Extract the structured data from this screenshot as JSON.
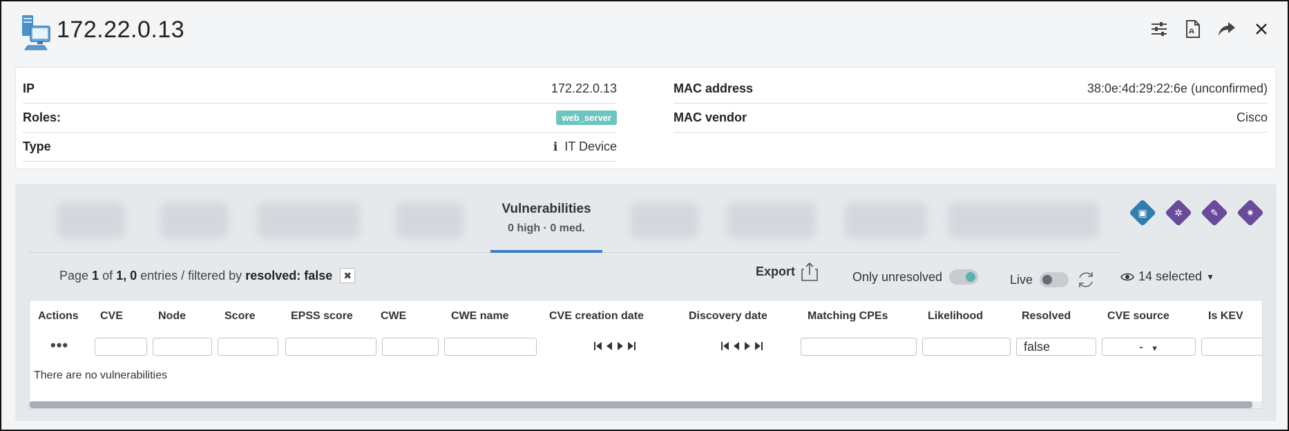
{
  "header": {
    "title": "172.22.0.13",
    "icons": [
      "network-device-icon",
      "settings-sliders-icon",
      "pdf-icon",
      "share-forward-icon",
      "close-icon"
    ]
  },
  "info": {
    "left": [
      {
        "label": "IP",
        "value": "172.22.0.13"
      },
      {
        "label": "Roles:",
        "badge": "web_server"
      },
      {
        "label": "Type",
        "value": "IT Device",
        "icon": "info-icon"
      }
    ],
    "right": [
      {
        "label": "MAC address",
        "value": "38:0e:4d:29:22:6e (unconfirmed)"
      },
      {
        "label": "MAC vendor",
        "value": "Cisco"
      }
    ]
  },
  "tabs": {
    "active": {
      "label": "Vulnerabilities",
      "summary": "0 high · 0 med."
    },
    "accent_color": "#3a7fc8"
  },
  "toolbar": {
    "page_word": "Page",
    "page_current": "1",
    "of_word": "of",
    "page_total": "1,",
    "entries_count": "0",
    "entries_text": "entries / filtered by",
    "filter_label": "resolved: false",
    "export_label": "Export",
    "only_unresolved_label": "Only unresolved",
    "live_label": "Live",
    "columns_selected": "14 selected"
  },
  "table": {
    "columns": [
      "Actions",
      "CVE",
      "Node",
      "Score",
      "EPSS score",
      "CWE",
      "CWE name",
      "CVE creation date",
      "Discovery date",
      "Matching CPEs",
      "Likelihood",
      "Resolved",
      "CVE source",
      "Is KEV"
    ],
    "filters": {
      "resolved": "false",
      "cve_source": "-"
    },
    "actions_label": "•••",
    "empty_message": "There are no vulnerabilities"
  }
}
